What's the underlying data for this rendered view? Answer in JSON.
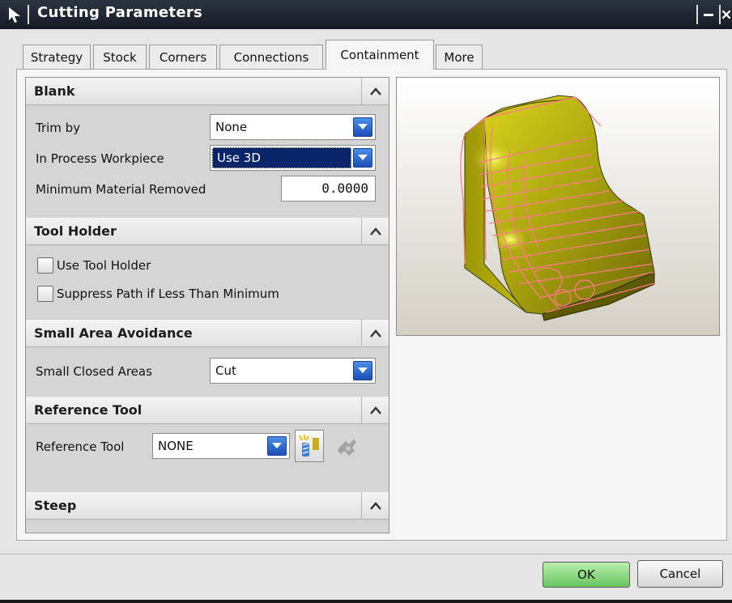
{
  "window": {
    "title": "Cutting Parameters"
  },
  "tabs": [
    {
      "label": "Strategy",
      "active": false
    },
    {
      "label": "Stock",
      "active": false
    },
    {
      "label": "Corners",
      "active": false
    },
    {
      "label": "Connections",
      "active": false
    },
    {
      "label": "Containment",
      "active": true
    },
    {
      "label": "More",
      "active": false
    }
  ],
  "sections": {
    "blank": {
      "title": "Blank",
      "trim_by": {
        "label": "Trim by",
        "value": "None"
      },
      "in_process_workpiece": {
        "label": "In Process Workpiece",
        "value": "Use 3D"
      },
      "minimum_material_removed": {
        "label": "Minimum Material Removed",
        "value": "0.0000"
      }
    },
    "tool_holder": {
      "title": "Tool Holder",
      "use_tool_holder": {
        "label": "Use Tool Holder",
        "checked": false
      },
      "suppress_path": {
        "label": "Suppress Path if Less Than Minimum",
        "checked": false
      }
    },
    "small_area_avoidance": {
      "title": "Small Area Avoidance",
      "small_closed_areas": {
        "label": "Small Closed Areas",
        "value": "Cut"
      }
    },
    "reference_tool": {
      "title": "Reference Tool",
      "reference_tool": {
        "label": "Reference Tool",
        "value": "NONE"
      }
    },
    "steep": {
      "title": "Steep"
    }
  },
  "buttons": {
    "ok": "OK",
    "cancel": "Cancel"
  },
  "colors": {
    "titlebar": "#1b212b",
    "dropdown_arrow": "#2a62d0",
    "selection": "#0a246a",
    "ok_button": "#8bd97c",
    "part_yellow": "#b9b212",
    "toolpath_pink": "#ff7a8a"
  },
  "icons": [
    "cursor-arrow-icon",
    "minimize-icon",
    "close-icon",
    "collapse-up-icon",
    "dropdown-arrow-icon",
    "select-tool-icon",
    "display-tool-icon"
  ]
}
